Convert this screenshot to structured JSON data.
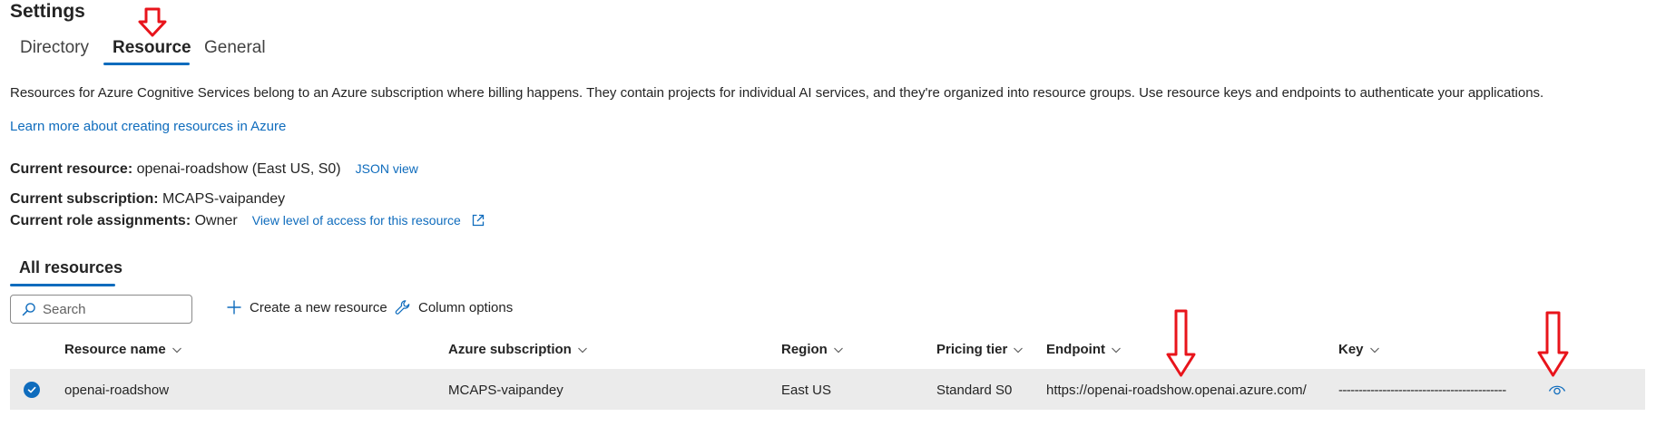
{
  "header": {
    "title": "Settings"
  },
  "tabs": [
    {
      "label": "Directory"
    },
    {
      "label": "Resource"
    },
    {
      "label": "General"
    }
  ],
  "description": "Resources for Azure Cognitive Services belong to an Azure subscription where billing happens. They contain projects for individual AI services, and they're organized into resource groups. Use resource keys and endpoints to authenticate your applications.",
  "learn_more_link": "Learn more about creating resources in Azure",
  "current_resource": {
    "label": "Current resource:",
    "value": " openai-roadshow (East US, S0)",
    "link": "JSON view"
  },
  "current_subscription": {
    "label": "Current subscription:",
    "value": " MCAPS-vaipandey"
  },
  "current_roles": {
    "label": "Current role assignments:",
    "value": " Owner",
    "link": "View level of access for this resource"
  },
  "all_resources": {
    "title": "All resources",
    "search": {
      "placeholder": "Search",
      "value": ""
    },
    "toolbar": {
      "create_label": "Create a new resource",
      "columns_label": "Column options"
    },
    "columns": [
      "Resource name",
      "Azure subscription",
      "Region",
      "Pricing tier",
      "Endpoint",
      "Key"
    ],
    "rows": [
      {
        "selected": true,
        "resource_name": "openai-roadshow",
        "subscription": "MCAPS-vaipandey",
        "region": "East US",
        "pricing_tier": "Standard S0",
        "endpoint": "https://openai-roadshow.openai.azure.com/",
        "key": "------------------------------------------"
      }
    ]
  },
  "colors": {
    "accent": "#0f6cbd",
    "row_selected": "#ebebeb",
    "annotation": "#e8141b"
  },
  "icons": [
    "search-icon",
    "add-icon",
    "wrench-icon",
    "chevron-down-icon",
    "checkmark-icon",
    "external-link-icon",
    "eye-icon",
    "down-arrow-annotation-icon"
  ]
}
